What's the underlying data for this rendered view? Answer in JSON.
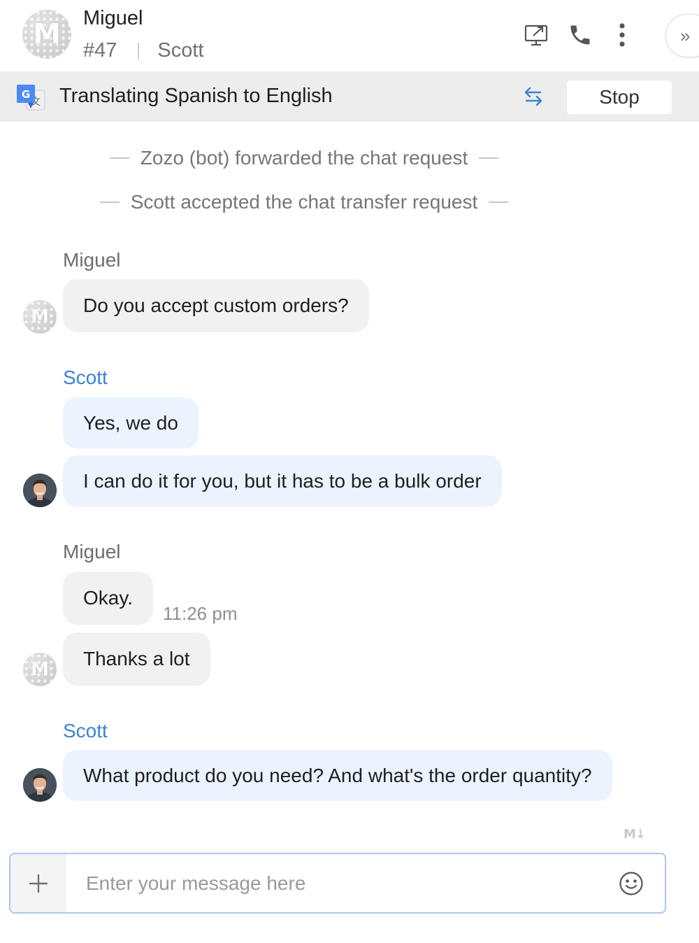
{
  "header": {
    "contact_name": "Miguel",
    "avatar_initial": "M",
    "ticket_number": "#47",
    "assigned_agent": "Scott",
    "icons": [
      "screen-share-icon",
      "phone-icon",
      "more-vertical-icon",
      "expand-panel-icon"
    ],
    "collapse_label": "»"
  },
  "translation_bar": {
    "text": "Translating Spanish to English",
    "stop_label": "Stop",
    "icons": [
      "google-translate-icon",
      "swap-languages-icon"
    ]
  },
  "system_messages": [
    "Zozo (bot) forwarded the chat request",
    "Scott accepted the chat transfer request"
  ],
  "groups": [
    {
      "sender": "Miguel",
      "role": "customer",
      "messages": [
        "Do you accept custom orders?"
      ]
    },
    {
      "sender": "Scott",
      "role": "agent",
      "messages": [
        "Yes, we do",
        "I can do it for you, but it has to be a bulk order"
      ]
    },
    {
      "sender": "Miguel",
      "role": "customer",
      "messages": [
        "Okay.",
        "Thanks a lot"
      ],
      "timestamp": "11:26 pm"
    },
    {
      "sender": "Scott",
      "role": "agent",
      "messages": [
        "What product do you need? And what's the order quantity?"
      ]
    }
  ],
  "composer": {
    "placeholder": "Enter your message here",
    "markdown_badge": "M↓",
    "icons": [
      "plus-icon",
      "emoji-icon"
    ]
  },
  "colors": {
    "agent_name": "#3b82d6",
    "agent_bubble": "#eaf3fe",
    "customer_bubble": "#f1f1f1",
    "translation_bar": "#ededed",
    "composer_border": "#a9c8ee"
  }
}
